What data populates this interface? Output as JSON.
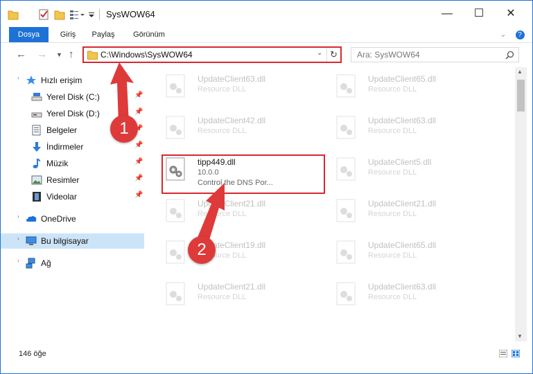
{
  "window": {
    "title": "SysWOW64",
    "controls": [
      "minimize",
      "maximize",
      "close"
    ]
  },
  "ribbon": {
    "tabs": [
      "Dosya",
      "Giriş",
      "Paylaş",
      "Görünüm"
    ]
  },
  "address": {
    "path": "C:\\Windows\\SysWOW64",
    "search_placeholder": "Ara: SysWOW64"
  },
  "sidebar": {
    "items": [
      {
        "label": "Hızlı erişim",
        "icon": "star-icon"
      },
      {
        "label": "Yerel Disk (C:)",
        "icon": "drive-icon",
        "pinned": true
      },
      {
        "label": "Yerel Disk (D:)",
        "icon": "drive-icon",
        "pinned": true
      },
      {
        "label": "Belgeler",
        "icon": "documents-icon",
        "pinned": true
      },
      {
        "label": "İndirmeler",
        "icon": "downloads-icon",
        "pinned": true
      },
      {
        "label": "Müzik",
        "icon": "music-icon",
        "pinned": true
      },
      {
        "label": "Resimler",
        "icon": "pictures-icon",
        "pinned": true
      },
      {
        "label": "Videolar",
        "icon": "videos-icon",
        "pinned": true
      },
      {
        "label": "OneDrive",
        "icon": "onedrive-icon"
      },
      {
        "label": "Bu bilgisayar",
        "icon": "computer-icon",
        "selected": true
      },
      {
        "label": "Ağ",
        "icon": "network-icon"
      }
    ]
  },
  "files": {
    "col1": [
      {
        "name": "UpdateClient63.dll",
        "desc": "Resource DLL"
      },
      {
        "name": "UpdateClient42.dll",
        "desc": "Resource DLL"
      },
      {
        "name": "tipp449.dll",
        "version": "10.0.0",
        "desc": "Control the DNS Por..."
      },
      {
        "name": "UpdateClient21.dll",
        "desc": "Resource DLL"
      },
      {
        "name": "UpdateClient19.dll",
        "desc": "Resource DLL"
      },
      {
        "name": "UpdateClient21.dll",
        "desc": "Resource DLL"
      }
    ],
    "col2": [
      {
        "name": "UpdateClient65.dll",
        "desc": "Resource DLL"
      },
      {
        "name": "UpdateClient63.dll",
        "desc": "Resource DLL"
      },
      {
        "name": "UpdateClient5.dll",
        "desc": "Resource DLL"
      },
      {
        "name": "UpdateClient21.dll",
        "desc": "Resource DLL"
      },
      {
        "name": "UpdateClient65.dll",
        "desc": "Resource DLL"
      },
      {
        "name": "UpdateClient63.dll",
        "desc": "Resource DLL"
      }
    ]
  },
  "status": {
    "item_count": "146 öğe"
  },
  "annotations": {
    "step1": "1",
    "step2": "2",
    "color": "#de3a3a"
  }
}
